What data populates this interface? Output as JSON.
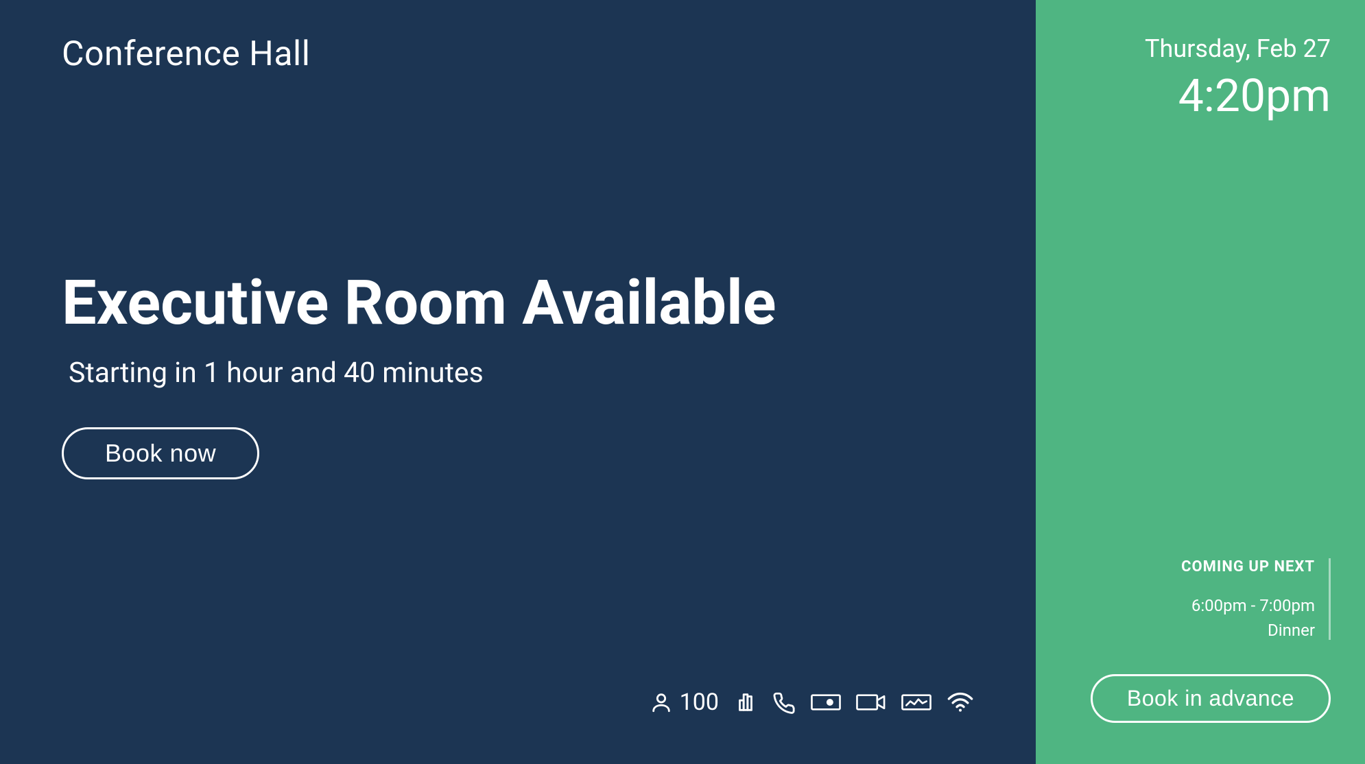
{
  "room_name": "Conference Hall",
  "status": {
    "heading": "Executive Room Available",
    "starting_in": "Starting in 1 hour and 40 minutes",
    "book_now_label": "Book now"
  },
  "features": {
    "capacity": "100"
  },
  "datetime": {
    "date": "Thursday, Feb 27",
    "time": "4:20pm"
  },
  "upnext": {
    "label": "COMING UP NEXT",
    "time_range": "6:00pm - 7:00pm",
    "title": "Dinner"
  },
  "book_advance_label": "Book in advance"
}
